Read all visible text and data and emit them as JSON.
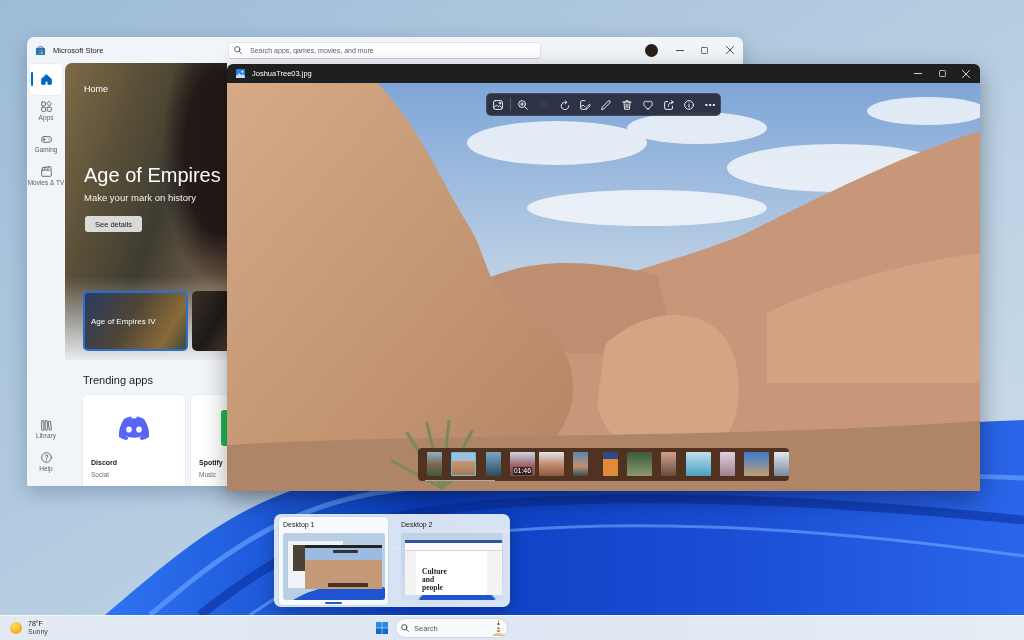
{
  "store_window": {
    "title": "Microsoft Store",
    "search": {
      "placeholder": "Search apps, games, movies, and more"
    },
    "sidebar": {
      "items": [
        {
          "kind": "home",
          "selected": true
        },
        {
          "kind": "apps",
          "label": "Apps",
          "selected": false
        },
        {
          "kind": "gaming",
          "label": "Gaming",
          "selected": false
        },
        {
          "kind": "movies",
          "label": "Movies & TV",
          "selected": false
        }
      ],
      "footer_items": [
        {
          "kind": "library",
          "label": "Library",
          "selected": false
        },
        {
          "kind": "help",
          "label": "Help",
          "selected": false
        }
      ]
    },
    "hero": {
      "heading": "Home",
      "title": "Age of Empires",
      "subtitle": "Make your mark on history",
      "button": "See details"
    },
    "carousel": [
      {
        "title": "Age of Empires IV",
        "selected": true
      },
      {
        "selected": false
      }
    ],
    "trending": {
      "heading": "Trending apps",
      "apps": [
        {
          "kind": "discord",
          "name": "Discord",
          "category": "Social"
        },
        {
          "kind": "spotify",
          "name": "Spotify",
          "category": "Music"
        }
      ]
    }
  },
  "photos_window": {
    "title": "JoshuaTree03.jpg",
    "toolbar": [
      {
        "kind": "view",
        "disabled": false
      },
      {
        "kind": "separator"
      },
      {
        "kind": "zoom-in",
        "disabled": false
      },
      {
        "kind": "zoom-out",
        "disabled": true
      },
      {
        "kind": "rotate",
        "disabled": false
      },
      {
        "kind": "edit",
        "disabled": false
      },
      {
        "kind": "draw",
        "disabled": false
      },
      {
        "kind": "delete",
        "disabled": false
      },
      {
        "kind": "favorite",
        "disabled": false
      },
      {
        "kind": "share",
        "disabled": false
      },
      {
        "kind": "info",
        "disabled": false
      },
      {
        "kind": "more",
        "disabled": false
      }
    ],
    "filmstrip": [
      {
        "portrait": true,
        "selected": false
      },
      {
        "portrait": false,
        "selected": true
      },
      {
        "portrait": true,
        "selected": false
      },
      {
        "portrait": false,
        "selected": false,
        "duration": "01:46"
      },
      {
        "portrait": false,
        "selected": false
      },
      {
        "portrait": true,
        "selected": false
      },
      {
        "portrait": true,
        "selected": false
      },
      {
        "portrait": false,
        "selected": false
      },
      {
        "portrait": true,
        "selected": false
      },
      {
        "portrait": false,
        "selected": false
      },
      {
        "portrait": true,
        "selected": false
      },
      {
        "portrait": false,
        "selected": false
      },
      {
        "portrait": false,
        "selected": false
      }
    ]
  },
  "task_view": {
    "desktops": [
      {
        "label": "Desktop 1",
        "selected": true
      },
      {
        "label": "Desktop 2",
        "selected": false,
        "document_title": "Culture and people"
      }
    ]
  },
  "taskbar": {
    "weather": {
      "temperature": "78°F",
      "condition": "Sunny"
    },
    "search": {
      "placeholder": "Search"
    }
  }
}
